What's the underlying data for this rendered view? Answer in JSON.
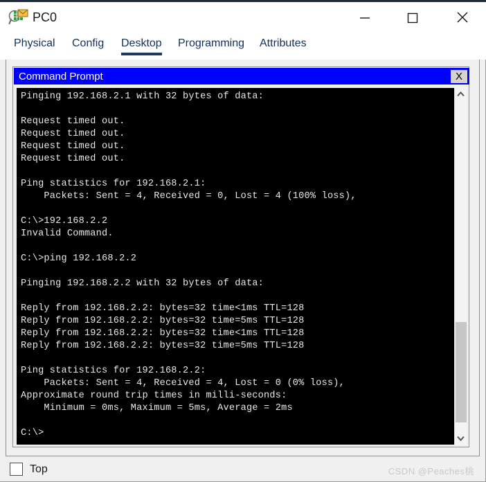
{
  "window": {
    "title": "PC0",
    "icon": "packet-tracer-inspect-icon",
    "controls": {
      "minimize_label": "–",
      "maximize_label": "□",
      "close_label": "✕"
    }
  },
  "tabs": [
    {
      "id": "physical",
      "label": "Physical",
      "active": false
    },
    {
      "id": "config",
      "label": "Config",
      "active": false
    },
    {
      "id": "desktop",
      "label": "Desktop",
      "active": true
    },
    {
      "id": "programming",
      "label": "Programming",
      "active": false
    },
    {
      "id": "attributes",
      "label": "Attributes",
      "active": false
    }
  ],
  "command_prompt": {
    "title": "Command Prompt",
    "close_label": "X",
    "terminal_text": "Pinging 192.168.2.1 with 32 bytes of data:\n\nRequest timed out.\nRequest timed out.\nRequest timed out.\nRequest timed out.\n\nPing statistics for 192.168.2.1:\n    Packets: Sent = 4, Received = 0, Lost = 4 (100% loss),\n\nC:\\>192.168.2.2\nInvalid Command.\n\nC:\\>ping 192.168.2.2\n\nPinging 192.168.2.2 with 32 bytes of data:\n\nReply from 192.168.2.2: bytes=32 time<1ms TTL=128\nReply from 192.168.2.2: bytes=32 time=5ms TTL=128\nReply from 192.168.2.2: bytes=32 time<1ms TTL=128\nReply from 192.168.2.2: bytes=32 time=5ms TTL=128\n\nPing statistics for 192.168.2.2:\n    Packets: Sent = 4, Received = 4, Lost = 0 (0% loss),\nApproximate round trip times in milli-seconds:\n    Minimum = 0ms, Maximum = 5ms, Average = 2ms\n\nC:\\>",
    "scrollbar": {
      "up_icon": "chevron-up-icon",
      "down_icon": "chevron-down-icon"
    }
  },
  "footer": {
    "top_checkbox_checked": false,
    "top_label": "Top",
    "watermark": "CSDN @Peaches桃"
  },
  "colors": {
    "title_accent": "#1d2b36",
    "tab_text": "#12305c",
    "tab_underline": "#1d3a5c",
    "cmd_titlebar": "#0000ff",
    "terminal_bg": "#000000",
    "terminal_fg": "#e8e8e8",
    "panel_bg": "#f0f0f0"
  }
}
